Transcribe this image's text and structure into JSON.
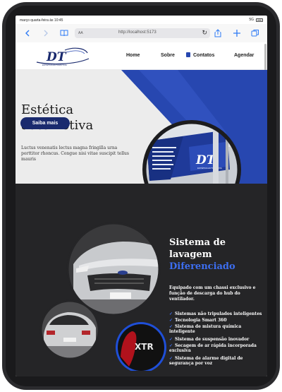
{
  "status": {
    "time": "março quarta-feira às 10:45",
    "signal": "5G"
  },
  "browser": {
    "text_size": "AA",
    "url": "http://localhost:5173"
  },
  "nav": {
    "home": "Home",
    "about": "Sobre",
    "contacts": "Contatos",
    "schedule": "Agendar"
  },
  "logo": {
    "letters": "DT",
    "tagline": "ESTÉTICA AUTOMOTIVA"
  },
  "hero": {
    "title_line1": "Estética",
    "title_line2": "automotiva",
    "text": "Luctus venenatis lectus magna fringilla urna porttitor rhoncus. Congue nisi vitae suscipit tellus mauris",
    "cta": "Saiba mais"
  },
  "sign": {
    "brand": "DT",
    "tagline": "ESTÉTICA AUTOMOTIVA"
  },
  "section": {
    "title_line1": "Sistema de",
    "title_line2": "lavagem",
    "title_highlight": "Diferenciado",
    "subtitle": "Equipado com um chassi exclusivo e função de descarga do hub do ventilador.",
    "features": [
      "Sistemas não tripulados inteligentes",
      "Tecnologia Smart 360",
      "Sistema de mistura química inteligente",
      "Sistema de suspensão inovador",
      "Secagem de ar rápida incorporada exclusiva",
      "Sistema de alarme digital de segurança por voz"
    ]
  },
  "badge": {
    "text": "XTR"
  },
  "colors": {
    "brand_blue": "#2747b0",
    "navy": "#1a2a6e",
    "accent_blue": "#3d6ef0",
    "dark_bg": "#252527"
  }
}
